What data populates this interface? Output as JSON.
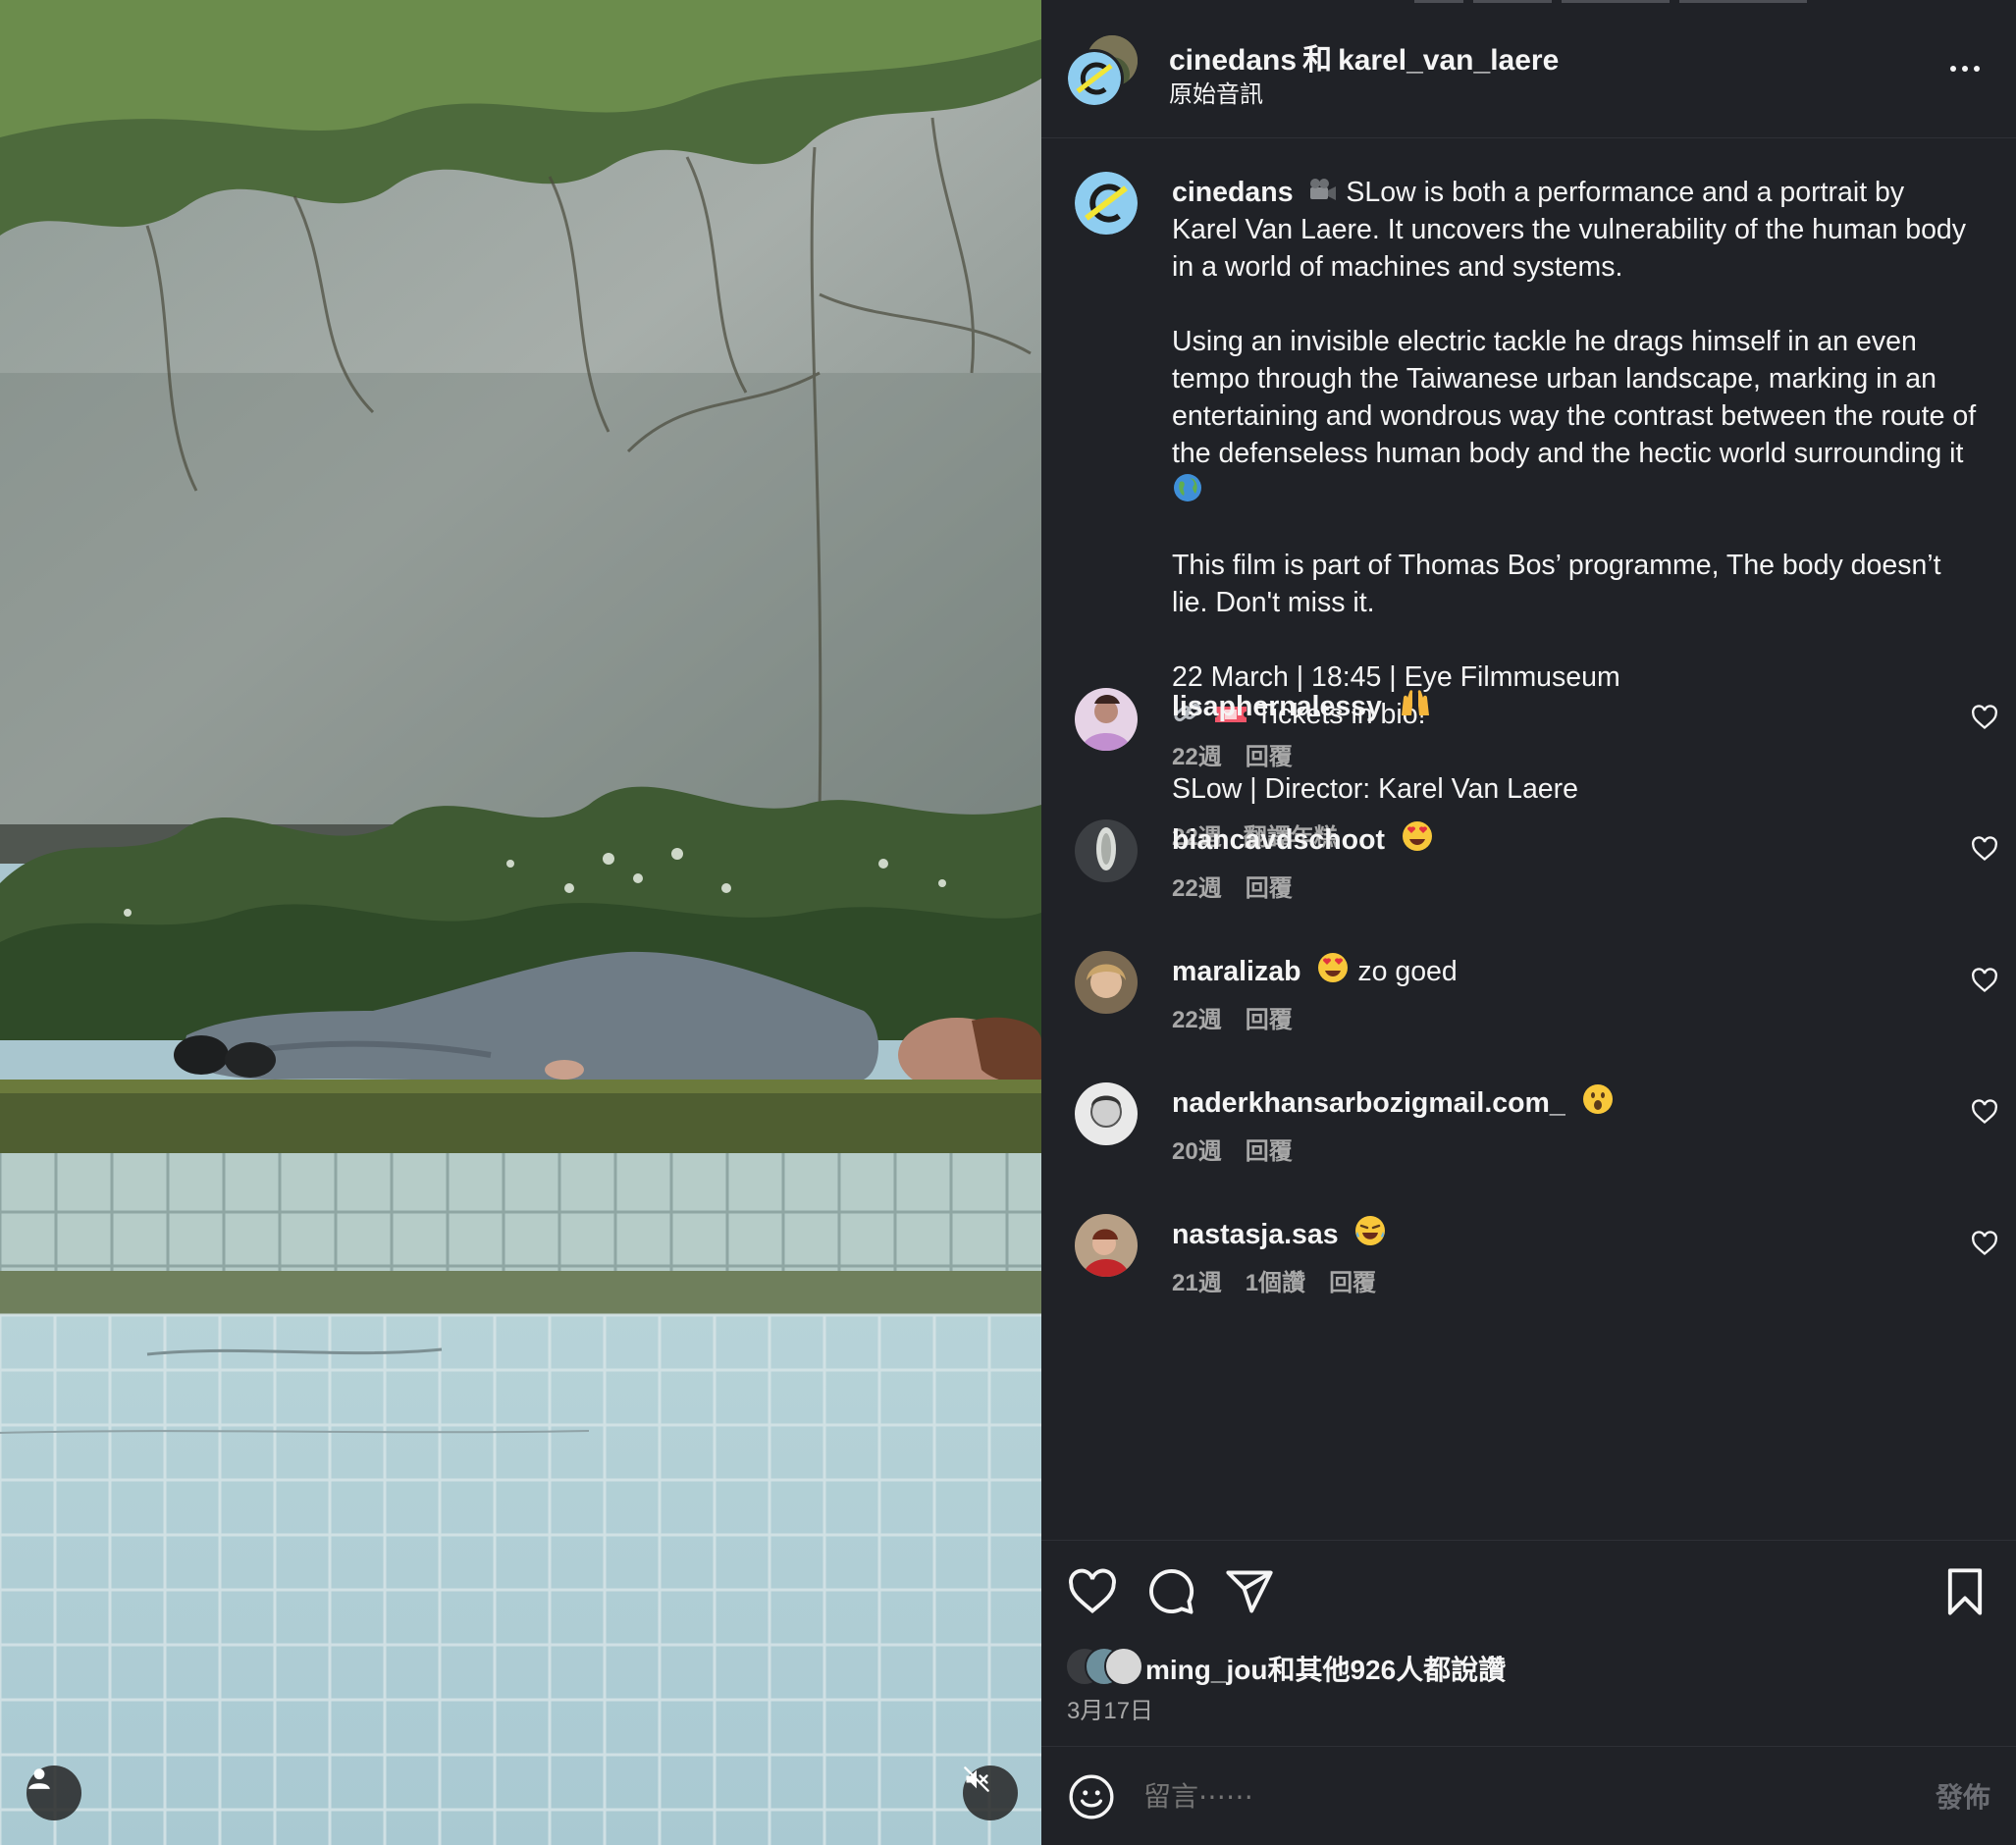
{
  "post": {
    "author": "cinedans",
    "conjunction": "和",
    "collaborator": "karel_van_laere",
    "audio": "原始音訊",
    "icons": [
      "user-tag-icon",
      "mute-icon",
      "more-icon"
    ]
  },
  "caption": {
    "username": "cinedans",
    "p1": "SLow is both a performance and a portrait by Karel Van Laere. It uncovers the vulnerability of the human body in a world of machines and systems.",
    "p2": "Using an invisible electric tackle he drags himself in an even tempo through the Taiwanese urban landscape, marking in an entertaining and wondrous way the contrast between the route of the defenseless human body and the hectic world surrounding it",
    "p3": "This film is part of Thomas Bos’ programme, The body doesn’t lie. Don't miss it.",
    "p4_line1": "22 March | 18:45 | Eye Filmmuseum",
    "p4_line2": "Tickets in bio!",
    "p5": "SLow | Director: Karel Van Laere",
    "time": "22週",
    "translate": "翻譯年糕"
  },
  "comments": [
    {
      "user": "lisaphernalessy",
      "text": "",
      "emoji": "raised-hands",
      "time": "22週",
      "likes": "",
      "reply": "回覆"
    },
    {
      "user": "biancavdschoot",
      "text": "",
      "emoji": "heart-eyes",
      "time": "22週",
      "likes": "",
      "reply": "回覆"
    },
    {
      "user": "maralizab",
      "text": "zo goed",
      "emoji": "heart-eyes",
      "time": "22週",
      "likes": "",
      "reply": "回覆"
    },
    {
      "user": "naderkhansarbozigmail.com_",
      "text": "",
      "emoji": "surprised",
      "time": "20週",
      "likes": "",
      "reply": "回覆"
    },
    {
      "user": "nastasja.sas",
      "text": "",
      "emoji": "laughing",
      "time": "21週",
      "likes": "1個讚",
      "reply": "回覆"
    }
  ],
  "actions": {
    "liked_by": "ming_jou和其他926人都說讚",
    "date": "3月17日"
  },
  "compose": {
    "placeholder": "留言⋯⋯",
    "post_label": "發佈"
  },
  "colors": {
    "panel_bg": "#202227",
    "text_primary": "#f5f5f5",
    "text_secondary": "#a8a8a8",
    "post_disabled": "#6a6c72"
  }
}
